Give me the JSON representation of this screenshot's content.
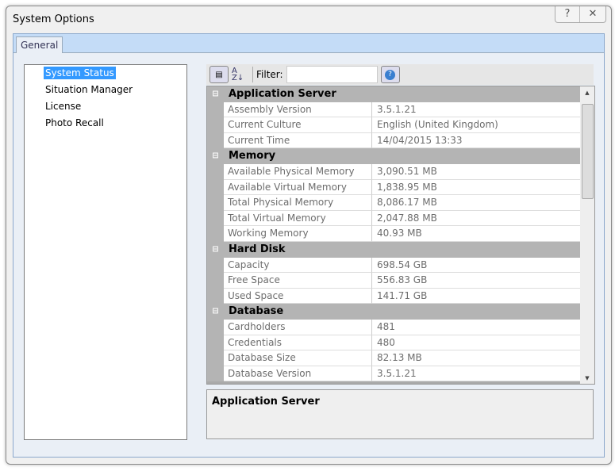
{
  "window": {
    "title": "System Options",
    "help": "?",
    "close": "✕"
  },
  "tabs": [
    {
      "label": "General"
    }
  ],
  "nav": [
    {
      "label": "System Status",
      "selected": true
    },
    {
      "label": "Situation Manager"
    },
    {
      "label": "License"
    },
    {
      "label": "Photo Recall"
    }
  ],
  "toolbar": {
    "filter_label": "Filter:",
    "filter_value": "",
    "sort_icon": "A Z↓"
  },
  "grid": [
    {
      "category": "Application Server",
      "props": [
        [
          "Assembly Version",
          "3.5.1.21"
        ],
        [
          "Current Culture",
          "English (United Kingdom)"
        ],
        [
          "Current Time",
          "14/04/2015 13:33"
        ]
      ]
    },
    {
      "category": "Memory",
      "props": [
        [
          "Available Physical Memory",
          "3,090.51 MB"
        ],
        [
          "Available Virtual Memory",
          "1,838.95 MB"
        ],
        [
          "Total Physical Memory",
          "8,086.17 MB"
        ],
        [
          "Total Virtual Memory",
          "2,047.88 MB"
        ],
        [
          "Working Memory",
          "40.93 MB"
        ]
      ]
    },
    {
      "category": "Hard Disk",
      "props": [
        [
          "Capacity",
          "698.54 GB"
        ],
        [
          "Free Space",
          "556.83 GB"
        ],
        [
          "Used Space",
          "141.71 GB"
        ]
      ]
    },
    {
      "category": "Database",
      "props": [
        [
          "Cardholders",
          "481"
        ],
        [
          "Credentials",
          "480"
        ],
        [
          "Database Size",
          "82.13 MB"
        ],
        [
          "Database Version",
          "3.5.1.21"
        ]
      ]
    }
  ],
  "description": {
    "title": "Application Server"
  }
}
